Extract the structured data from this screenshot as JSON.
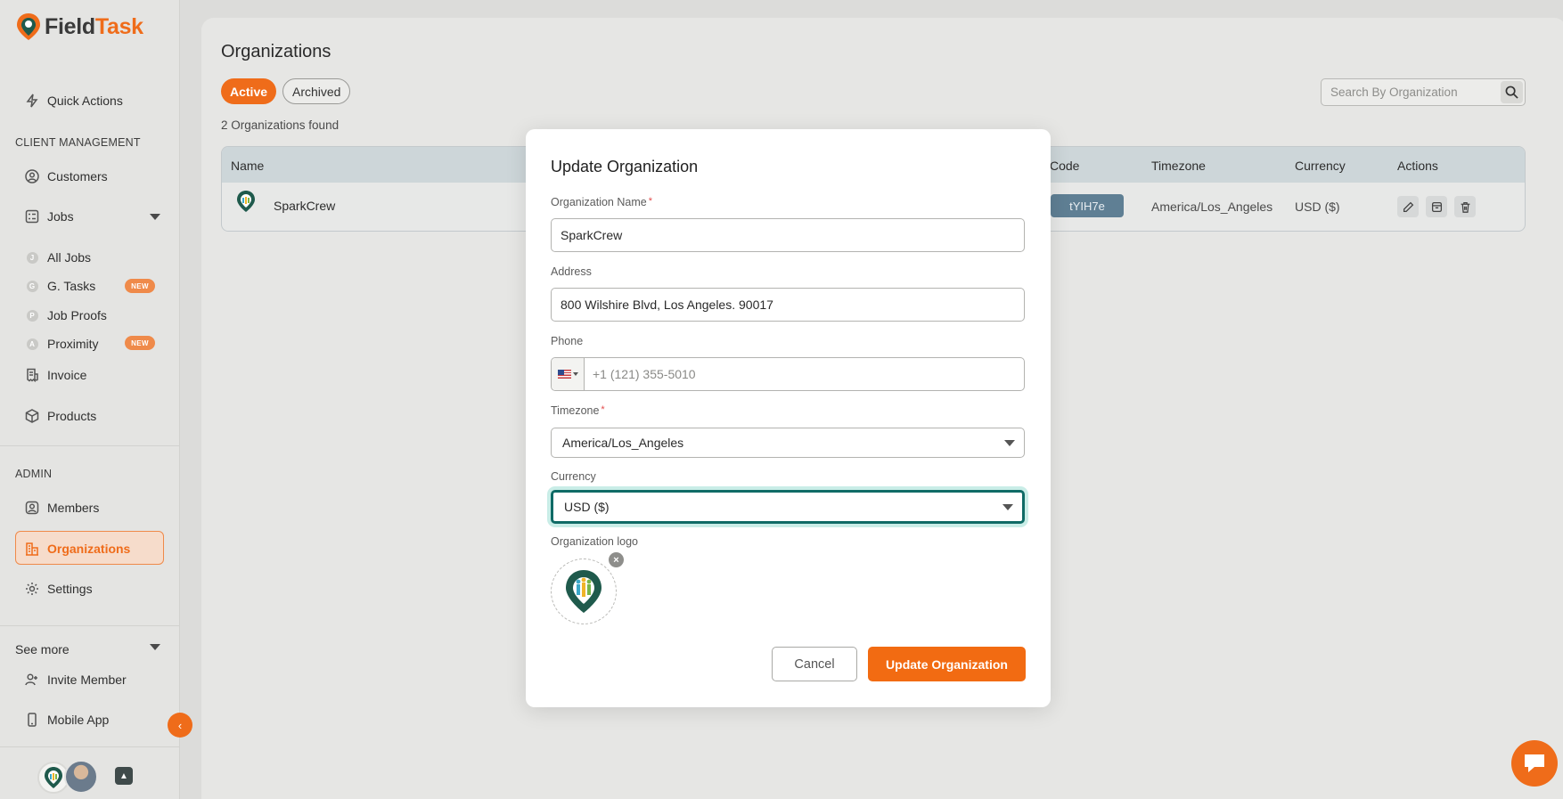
{
  "app": {
    "brand_part1": "Field",
    "brand_part2": "Task"
  },
  "sidebar": {
    "quick_actions": "Quick Actions",
    "client_management": "CLIENT MANAGEMENT",
    "customers": "Customers",
    "jobs": "Jobs",
    "all_jobs": "All Jobs",
    "g_tasks": "G. Tasks",
    "job_proofs": "Job Proofs",
    "proximity": "Proximity",
    "new_badge": "NEW",
    "invoice": "Invoice",
    "products": "Products",
    "admin": "ADMIN",
    "members": "Members",
    "organizations": "Organizations",
    "settings": "Settings",
    "see_more": "See more",
    "invite_member": "Invite Member",
    "mobile_app": "Mobile App",
    "sub_initials": [
      "J",
      "G",
      "P",
      "A"
    ]
  },
  "main": {
    "title": "Organizations",
    "tab_active": "Active",
    "tab_archived": "Archived",
    "count_text": "2 Organizations found",
    "search_placeholder": "Search By Organization",
    "table": {
      "headers": {
        "name": "Name",
        "code": "Code",
        "timezone": "Timezone",
        "currency": "Currency",
        "actions": "Actions"
      },
      "rows": [
        {
          "name": "SparkCrew",
          "code": "tYIH7e",
          "timezone": "America/Los_Angeles",
          "currency": "USD ($)"
        }
      ]
    }
  },
  "modal": {
    "title": "Update Organization",
    "org_name_label": "Organization Name",
    "org_name_value": "SparkCrew",
    "address_label": "Address",
    "address_value": "800 Wilshire Blvd, Los Angeles. 90017",
    "phone_label": "Phone",
    "phone_placeholder": "+1 (121) 355-5010",
    "timezone_label": "Timezone",
    "timezone_value": "America/Los_Angeles",
    "currency_label": "Currency",
    "currency_value": "USD ($)",
    "logo_label": "Organization logo",
    "required_mark": "*",
    "cancel_label": "Cancel",
    "update_label": "Update Organization"
  },
  "colors": {
    "accent": "#ef6c1a",
    "focus_ring": "#0f6b66",
    "code_chip": "#5f7f94"
  }
}
